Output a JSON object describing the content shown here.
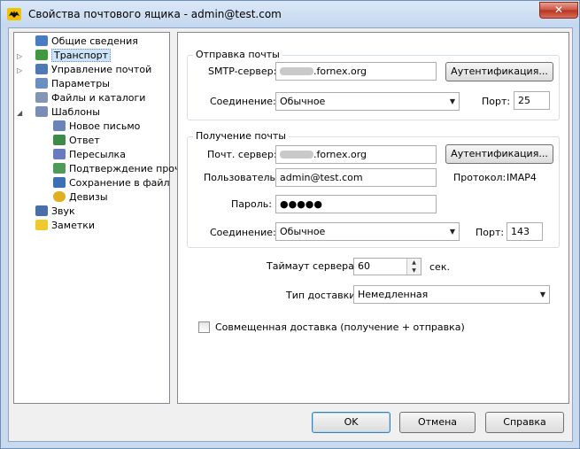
{
  "window": {
    "title": "Свойства почтового ящика - admin@test.com"
  },
  "tree": {
    "items": [
      {
        "label": "Общие сведения",
        "icon": "user-info-icon",
        "color": "#4a7cc4"
      },
      {
        "label": "Транспорт",
        "icon": "transport-icon",
        "color": "#3f9a3f",
        "selected": true
      },
      {
        "label": "Управление почтой",
        "icon": "mail-management-icon",
        "color": "#4f78b5"
      },
      {
        "label": "Параметры",
        "icon": "parameters-icon",
        "color": "#6b8fc1"
      },
      {
        "label": "Файлы и каталоги",
        "icon": "files-folders-icon",
        "color": "#8296b3"
      },
      {
        "label": "Шаблоны",
        "icon": "templates-icon",
        "color": "#7a8db6"
      },
      {
        "label": "Новое письмо",
        "icon": "new-letter-icon",
        "color": "#6a84b8"
      },
      {
        "label": "Ответ",
        "icon": "reply-icon",
        "color": "#3f8a48"
      },
      {
        "label": "Пересылка",
        "icon": "forward-icon",
        "color": "#6a7ac0"
      },
      {
        "label": "Подтверждение проч",
        "icon": "read-confirmation-icon",
        "color": "#4f9a5a"
      },
      {
        "label": "Сохранение в файл",
        "icon": "save-to-file-icon",
        "color": "#3c6fb5"
      },
      {
        "label": "Девизы",
        "icon": "mottos-icon",
        "color": "#e0b020"
      },
      {
        "label": "Звук",
        "icon": "sound-icon",
        "color": "#4a6fa8"
      },
      {
        "label": "Заметки",
        "icon": "notes-icon",
        "color": "#f0c830"
      }
    ]
  },
  "send": {
    "title": "Отправка почты",
    "server_label": "SMTP-сервер:",
    "server_value": ".fornex.org",
    "auth_button": "Аутентификация...",
    "connection_label": "Соединение:",
    "connection_value": "Обычное",
    "port_label": "Порт:",
    "port_value": "25"
  },
  "receive": {
    "title": "Получение почты",
    "server_label": "Почт. сервер:",
    "server_value": ".fornex.org",
    "auth_button": "Аутентификация...",
    "user_label": "Пользователь:",
    "user_value": "admin@test.com",
    "protocol_label": "Протокол:",
    "protocol_value": "IMAP4",
    "password_label": "Пароль:",
    "password_value": "●●●●●",
    "connection_label": "Соединение:",
    "connection_value": "Обычное",
    "port_label": "Порт:",
    "port_value": "143"
  },
  "timeout": {
    "label": "Таймаут сервера:",
    "value": "60",
    "unit": "сек."
  },
  "delivery": {
    "label": "Тип доставки:",
    "value": "Немедленная"
  },
  "combined": {
    "label": "Совмещенная доставка (получение + отправка)",
    "checked": false
  },
  "buttons": {
    "ok": "OK",
    "cancel": "Отмена",
    "help": "Справка"
  }
}
